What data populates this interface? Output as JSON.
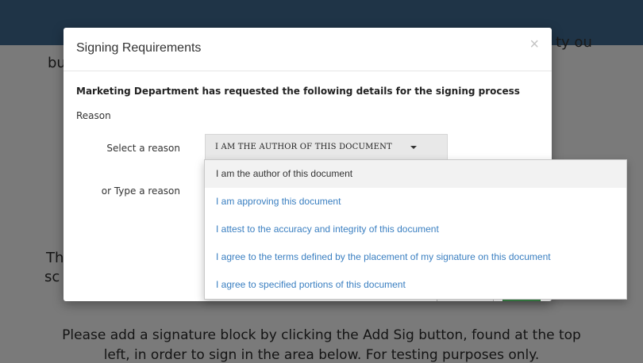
{
  "background": {
    "partial_left_1": "bu",
    "partial_left_2": "Th",
    "partial_left_3": "sc",
    "partial_right_1": "ty ou",
    "bottom_line_1": "Please add a signature block by clicking the Add Sig button, found at the top",
    "bottom_line_2": "left, in order to sign in the area below. For testing purposes only."
  },
  "modal": {
    "title": "Signing Requirements",
    "close_glyph": "×",
    "request_text": "Marketing Department has requested the following details for the signing process",
    "section_label": "Reason",
    "select_label": "Select a reason",
    "type_label": "or Type a reason",
    "selected_value": "I AM THE AUTHOR OF THIS DOCUMENT"
  },
  "dropdown": {
    "options": [
      "I am the author of this document",
      "I am approving this document",
      "I attest to the accuracy and integrity of this document",
      "I agree to the terms defined by the placement of my signature on this document",
      "I agree to specified portions of this document"
    ],
    "selected_index": 0
  },
  "colors": {
    "topbar": "#1f3447",
    "overlay": "#7a7a7a",
    "link": "#3a7fc1",
    "ok_button": "#3c8a4a"
  }
}
